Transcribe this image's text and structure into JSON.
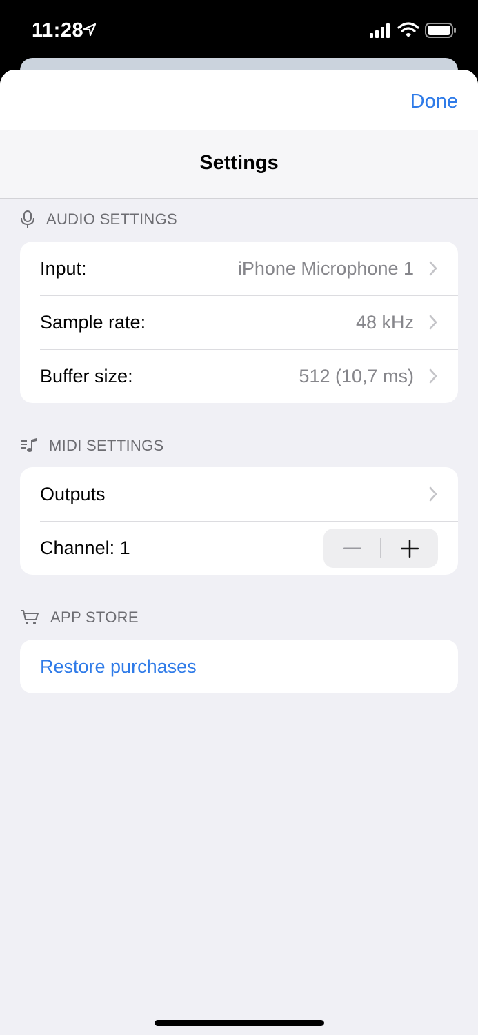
{
  "status_bar": {
    "time": "11:28"
  },
  "header": {
    "done_label": "Done",
    "title": "Settings"
  },
  "audio_settings": {
    "header": "AUDIO SETTINGS",
    "icon": "microphone-icon",
    "rows": [
      {
        "label": "Input:",
        "value": "iPhone Microphone 1"
      },
      {
        "label": "Sample rate:",
        "value": "48 kHz"
      },
      {
        "label": "Buffer size:",
        "value": "512 (10,7 ms)"
      }
    ]
  },
  "midi_settings": {
    "header": "MIDI SETTINGS",
    "icon": "music-list-icon",
    "outputs_label": "Outputs",
    "channel_label": "Channel: 1"
  },
  "app_store": {
    "header": "APP STORE",
    "icon": "cart-icon",
    "restore_label": "Restore purchases"
  },
  "colors": {
    "accent": "#2f7be8",
    "background": "#f0f0f5",
    "secondary_text": "#86868b",
    "section_header": "#6d6d72"
  }
}
